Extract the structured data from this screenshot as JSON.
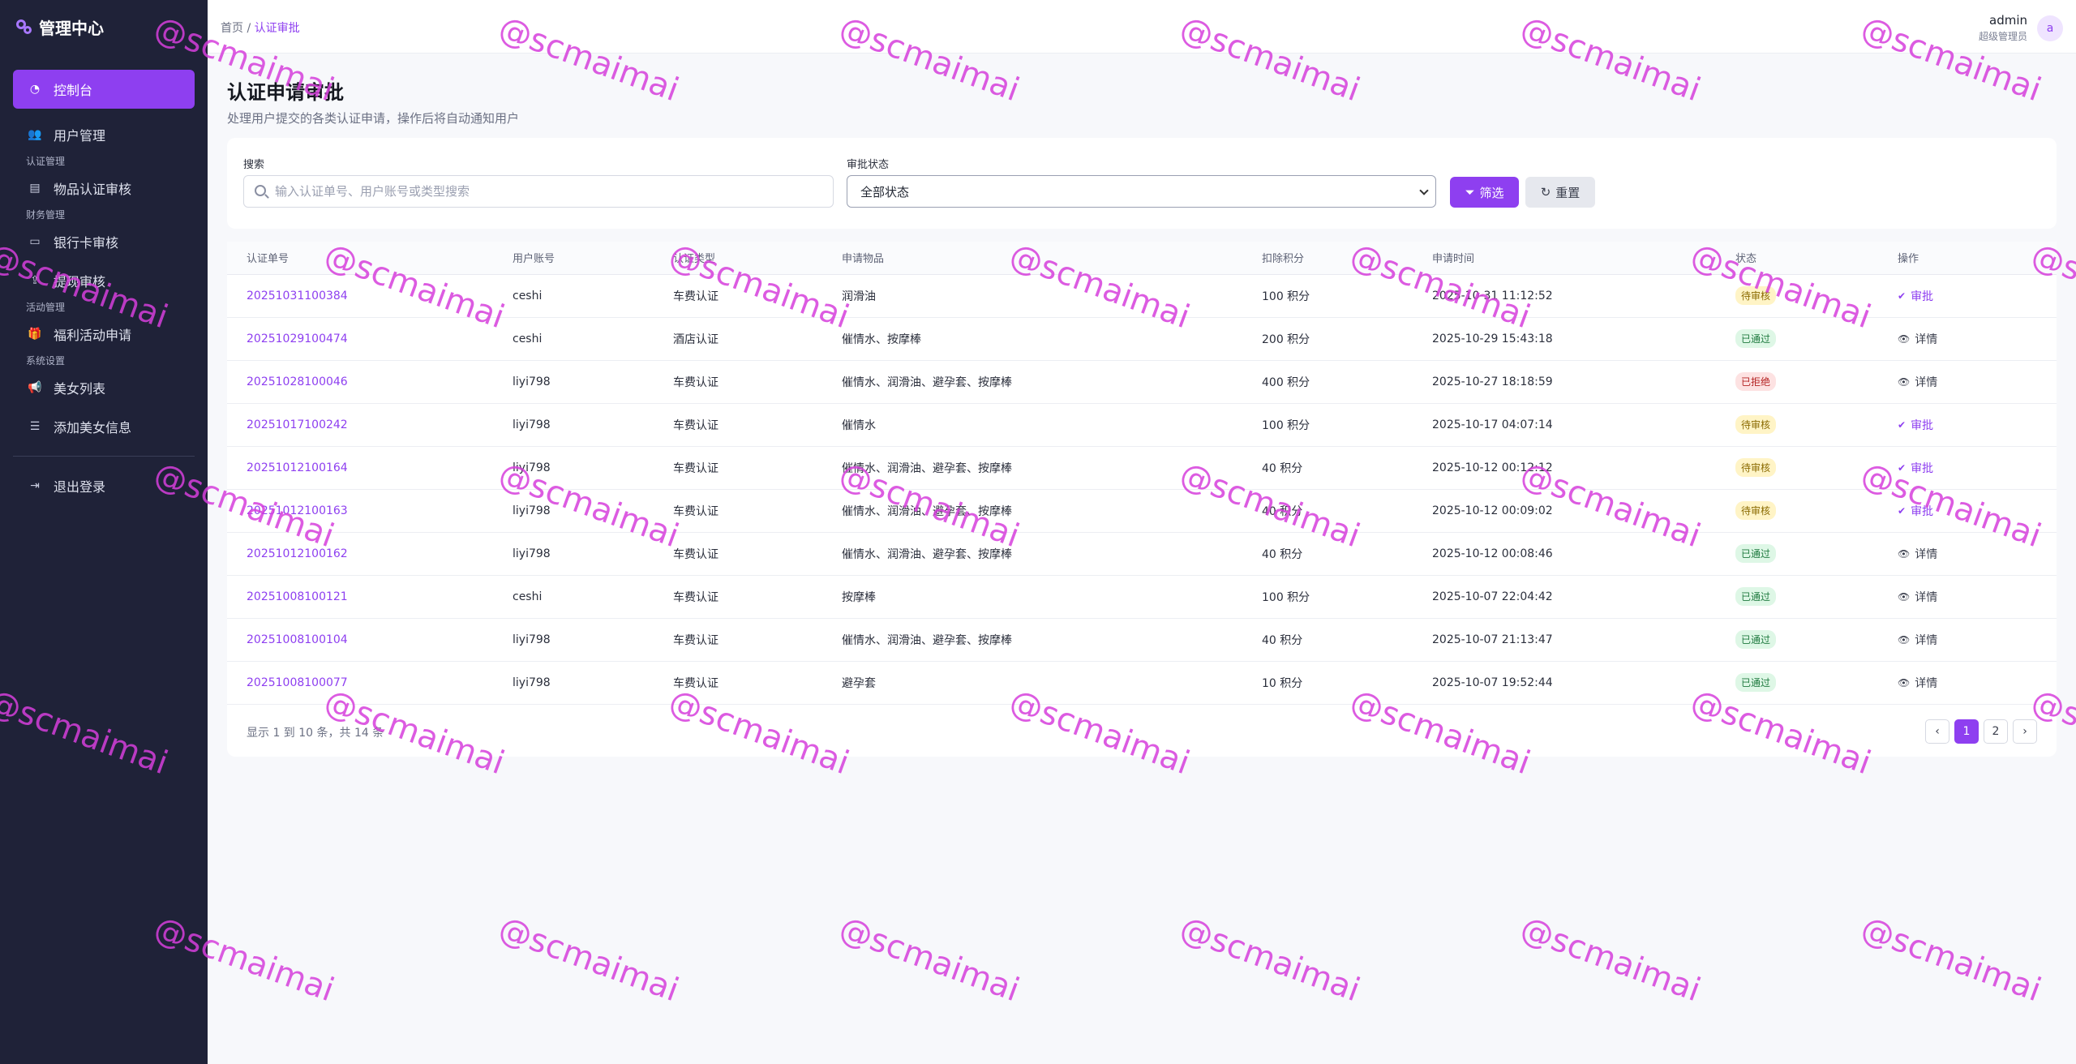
{
  "brand": {
    "title": "管理中心"
  },
  "sidebar": {
    "items": [
      {
        "label": "控制台",
        "icon": "dashboard-icon",
        "active": true
      },
      {
        "label": "用户管理",
        "icon": "users-icon"
      },
      {
        "group": "认证管理"
      },
      {
        "label": "物品认证审核",
        "icon": "id-card-icon"
      },
      {
        "group": "财务管理"
      },
      {
        "label": "银行卡审核",
        "icon": "credit-card-icon"
      },
      {
        "label": "提现审核",
        "icon": "withdraw-icon"
      },
      {
        "group": "活动管理"
      },
      {
        "label": "福利活动申请",
        "icon": "gift-icon"
      },
      {
        "group": "系统设置"
      },
      {
        "label": "美女列表",
        "icon": "megaphone-icon"
      },
      {
        "label": "添加美女信息",
        "icon": "sliders-icon"
      },
      {
        "label": "退出登录",
        "icon": "logout-icon"
      }
    ]
  },
  "header": {
    "crumb_home": "首页",
    "crumb_sep": "/",
    "crumb_current": "认证审批",
    "user_name": "admin",
    "user_role": "超级管理员",
    "avatar_letter": "a"
  },
  "page": {
    "title": "认证申请审批",
    "subtitle": "处理用户提交的各类认证申请，操作后将自动通知用户"
  },
  "filter": {
    "search_label": "搜索",
    "search_placeholder": "输入认证单号、用户账号或类型搜索",
    "status_label": "审批状态",
    "status_value": "全部状态",
    "filter_button": "筛选",
    "reset_button": "重置"
  },
  "table": {
    "columns": [
      "认证单号",
      "用户账号",
      "认证类型",
      "申请物品",
      "扣除积分",
      "申请时间",
      "状态",
      "操作"
    ],
    "rows": [
      {
        "id": "20251031100384",
        "user": "ceshi",
        "type": "车费认证",
        "item": "润滑油",
        "points": "100 积分",
        "time": "2025-10-31 11:12:52",
        "status": "待审核",
        "status_kind": "pending",
        "action": "审批"
      },
      {
        "id": "20251029100474",
        "user": "ceshi",
        "type": "酒店认证",
        "item": "催情水、按摩棒",
        "points": "200 积分",
        "time": "2025-10-29 15:43:18",
        "status": "已通过",
        "status_kind": "pass",
        "action": "详情"
      },
      {
        "id": "20251028100046",
        "user": "liyi798",
        "type": "车费认证",
        "item": "催情水、润滑油、避孕套、按摩棒",
        "points": "400 积分",
        "time": "2025-10-27 18:18:59",
        "status": "已拒绝",
        "status_kind": "reject",
        "action": "详情"
      },
      {
        "id": "20251017100242",
        "user": "liyi798",
        "type": "车费认证",
        "item": "催情水",
        "points": "100 积分",
        "time": "2025-10-17 04:07:14",
        "status": "待审核",
        "status_kind": "pending",
        "action": "审批"
      },
      {
        "id": "20251012100164",
        "user": "liyi798",
        "type": "车费认证",
        "item": "催情水、润滑油、避孕套、按摩棒",
        "points": "40 积分",
        "time": "2025-10-12 00:12:12",
        "status": "待审核",
        "status_kind": "pending",
        "action": "审批"
      },
      {
        "id": "20251012100163",
        "user": "liyi798",
        "type": "车费认证",
        "item": "催情水、润滑油、避孕套、按摩棒",
        "points": "40 积分",
        "time": "2025-10-12 00:09:02",
        "status": "待审核",
        "status_kind": "pending",
        "action": "审批"
      },
      {
        "id": "20251012100162",
        "user": "liyi798",
        "type": "车费认证",
        "item": "催情水、润滑油、避孕套、按摩棒",
        "points": "40 积分",
        "time": "2025-10-12 00:08:46",
        "status": "已通过",
        "status_kind": "pass",
        "action": "详情"
      },
      {
        "id": "20251008100121",
        "user": "ceshi",
        "type": "车费认证",
        "item": "按摩棒",
        "points": "100 积分",
        "time": "2025-10-07 22:04:42",
        "status": "已通过",
        "status_kind": "pass",
        "action": "详情"
      },
      {
        "id": "20251008100104",
        "user": "liyi798",
        "type": "车费认证",
        "item": "催情水、润滑油、避孕套、按摩棒",
        "points": "40 积分",
        "time": "2025-10-07 21:13:47",
        "status": "已通过",
        "status_kind": "pass",
        "action": "详情"
      },
      {
        "id": "20251008100077",
        "user": "liyi798",
        "type": "车费认证",
        "item": "避孕套",
        "points": "10 积分",
        "time": "2025-10-07 19:52:44",
        "status": "已通过",
        "status_kind": "pass",
        "action": "详情"
      }
    ]
  },
  "pagination": {
    "summary": "显示 1 到 10 条，共 14 条",
    "prev": "‹",
    "pages": [
      "1",
      "2"
    ],
    "current": "1",
    "next": "›"
  },
  "watermark": {
    "text": "@scmaimai"
  },
  "colors": {
    "accent": "#8e3ff0",
    "sidebar_bg": "#1f2238",
    "watermark": "#d63fdc"
  }
}
